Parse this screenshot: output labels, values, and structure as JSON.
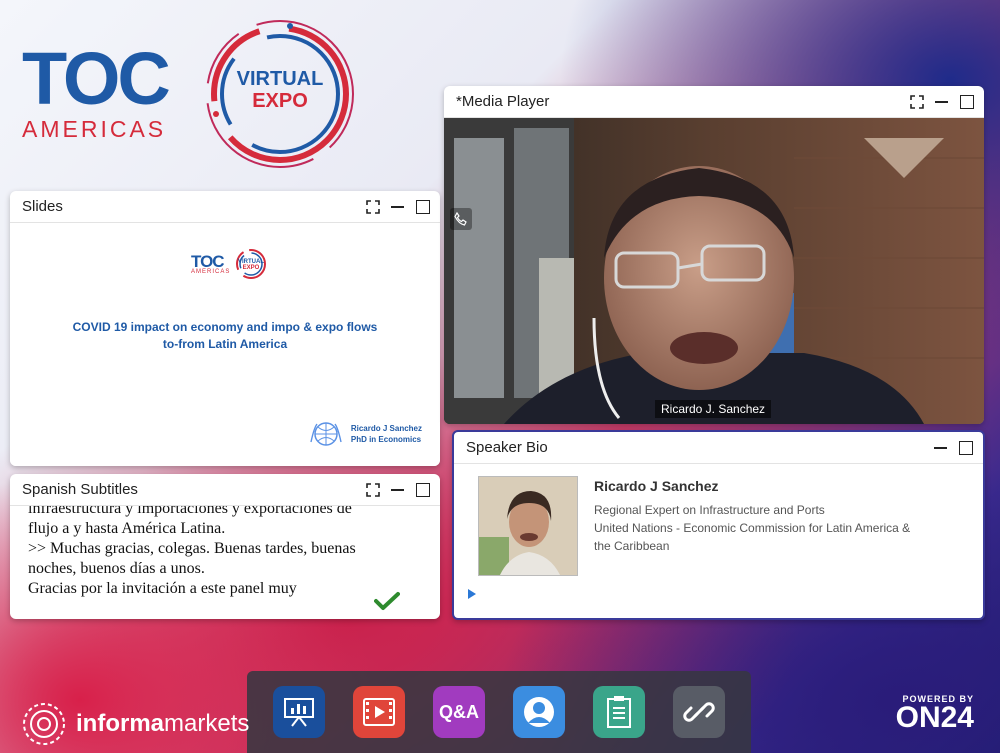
{
  "branding": {
    "toc_word": "TOC",
    "toc_sub": "AMERICAS",
    "expo_line1": "VIRTUAL",
    "expo_line2": "EXPO",
    "informa_bold": "informa",
    "informa_light": "markets",
    "on24_powered": "POWERED BY",
    "on24_name": "ON24"
  },
  "slides": {
    "title": "Slides",
    "logo_toc": "TOC",
    "logo_americas": "AMERICAS",
    "logo_virtual": "VIRTUAL",
    "logo_expo": "EXPO",
    "heading_line1": "COVID 19 impact on economy and impo & expo flows",
    "heading_line2": "to-from Latin America",
    "presenter": "Ricardo J Sanchez",
    "presenter_degree": "PhD in Economics"
  },
  "subtitles": {
    "title": "Spanish Subtitles",
    "lines": [
      "infraestructura y importaciones y exportaciones de",
      "flujo a y hasta América Latina.",
      ">> Muchas gracias, colegas.  Buenas tardes, buenas",
      "noches, buenos días a unos.",
      "Gracias por la invitación a este panel muy"
    ]
  },
  "media": {
    "title": "*Media Player",
    "speaker_tag": "Ricardo J. Sanchez"
  },
  "bio": {
    "title": "Speaker Bio",
    "name": "Ricardo J Sanchez",
    "role_line1": "Regional Expert on Infrastructure and Ports",
    "role_line2": "United Nations - Economic Commission for Latin America &",
    "role_line3": "the Caribbean"
  },
  "dock": {
    "items": [
      {
        "name": "slides-icon",
        "color": "#1a4f9c"
      },
      {
        "name": "media-player-icon",
        "color": "#e0453a"
      },
      {
        "name": "qa-icon",
        "label": "Q&A",
        "color": "#a13bbf"
      },
      {
        "name": "speaker-bio-icon",
        "color": "#3b8de0"
      },
      {
        "name": "notes-icon",
        "color": "#3aa58a"
      },
      {
        "name": "resources-link-icon",
        "color": "#585c66"
      }
    ]
  },
  "colors": {
    "brand_blue": "#1f5aa6",
    "brand_red": "#d52b3b",
    "check_green": "#2e8b2e"
  }
}
